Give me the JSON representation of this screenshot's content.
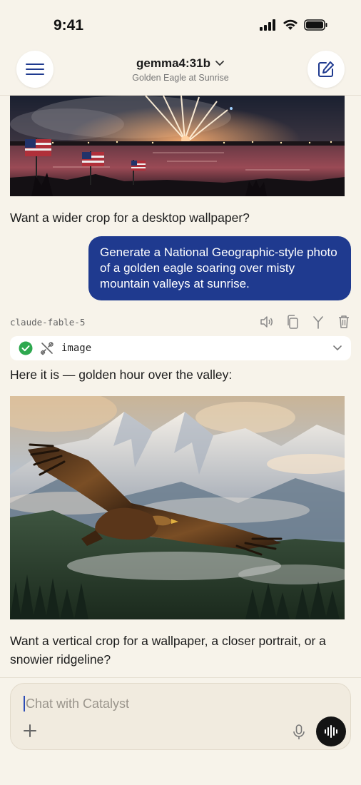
{
  "status_bar": {
    "time": "9:41"
  },
  "header": {
    "model": "gemma4:31b",
    "subtitle": "Golden Eagle at Sunrise"
  },
  "chat": {
    "messages": [
      {
        "role": "assistant",
        "text": "Want a wider crop for a desktop wallpaper?"
      },
      {
        "role": "user",
        "text": "Generate a National Geographic-style photo of a golden eagle soaring over misty mountain valleys at sunrise."
      },
      {
        "role": "assistant",
        "model_tag": "claude-fable-5",
        "tool": {
          "name": "image",
          "status": "success"
        },
        "text": "Here it is — golden hour over the valley:",
        "followup": "Want a vertical crop for a wallpaper, a closer portrait, or a snowier ridgeline?"
      }
    ]
  },
  "composer": {
    "placeholder": "Chat with Catalyst"
  },
  "colors": {
    "accent": "#1f3a8f",
    "background": "#f7f3ea",
    "success": "#2ea84f"
  }
}
